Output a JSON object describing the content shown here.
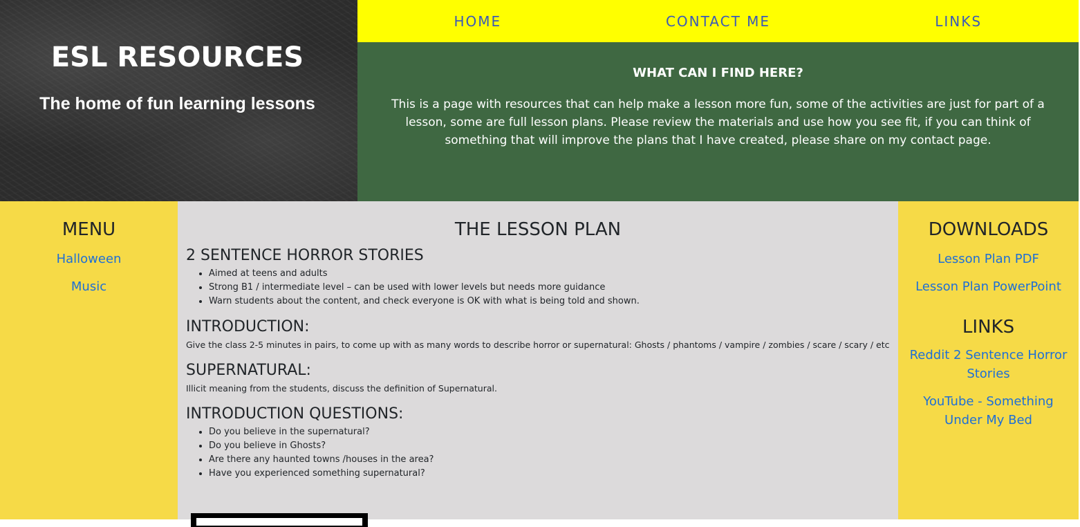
{
  "header": {
    "title": "ESL RESOURCES",
    "tagline": "The home of fun learning lessons"
  },
  "nav": {
    "home": "HOME",
    "contact": "CONTACT ME",
    "links": "LINKS"
  },
  "intro": {
    "heading": "WHAT CAN I FIND HERE?",
    "text": "This is a page with resources that can help make a lesson more fun, some of the activities are just for part of a lesson, some are full lesson plans. Please review the materials and use how you see fit, if you can think of something that will improve the plans that I have created, please share on my contact page."
  },
  "menu": {
    "heading": "MENU",
    "items": [
      "Halloween",
      "Music"
    ]
  },
  "lesson": {
    "title": "THE LESSON PLAN",
    "story_heading": "2 SENTENCE HORROR STORIES",
    "story_points": [
      "Aimed at teens and adults",
      "Strong B1 / intermediate level – can be used with lower levels but needs more guidance",
      "Warn students about the content, and check everyone is OK with what is being told and shown."
    ],
    "intro_heading": "INTRODUCTION:",
    "intro_text": "Give the class 2-5 minutes in pairs, to come up with as many words to describe horror or supernatural: Ghosts / phantoms / vampire / zombies / scare / scary / etc",
    "super_heading": "SUPERNATURAL:",
    "super_text": "Illicit meaning from the students, discuss the definition of Supernatural.",
    "questions_heading": "INTRODUCTION QUESTIONS:",
    "questions": [
      "Do you believe in the supernatural?",
      "Do you believe in Ghosts?",
      "Are there any haunted towns /houses in the area?",
      "Have you experienced something supernatural?"
    ]
  },
  "downloads": {
    "heading": "DOWNLOADS",
    "items": [
      "Lesson Plan PDF",
      "Lesson Plan PowerPoint"
    ]
  },
  "links": {
    "heading": "LINKS",
    "items": [
      "Reddit 2 Sentence Horror Stories",
      "YouTube - Something Under My Bed"
    ]
  },
  "colors": {
    "nav_bg": "#ffff00",
    "nav_text": "#3b5ab8",
    "intro_bg": "#3f6842",
    "side_bg": "#f6da47",
    "content_bg": "#dcdadb",
    "link": "#1e6fd6"
  }
}
